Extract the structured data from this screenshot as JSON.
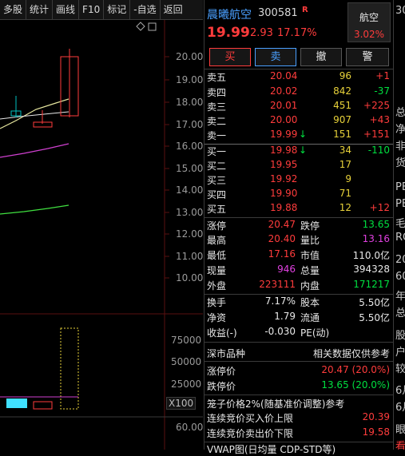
{
  "toolbar": {
    "buttons": [
      "多股",
      "统计",
      "画线",
      "F10",
      "标记",
      "-自选",
      "返回"
    ]
  },
  "chart": {
    "price_ticks": [
      "20.00",
      "19.00",
      "18.00",
      "17.00",
      "16.00",
      "15.00",
      "14.00",
      "13.00",
      "12.00",
      "11.00",
      "10.00"
    ],
    "volume_ticks": [
      "75000",
      "50000",
      "25000"
    ],
    "volume_unit": "X100",
    "bottom_tick": "60.00"
  },
  "stock": {
    "name": "晨曦航空",
    "code": "300581",
    "badge": "R",
    "price": "19.99",
    "change": "2.93",
    "change_pct": "17.17%",
    "sector": "航空",
    "sector_pct": "3.02%"
  },
  "actions": [
    "买",
    "卖",
    "撤",
    "警"
  ],
  "asks": [
    {
      "label": "卖五",
      "price": "20.04",
      "vol": "96",
      "delta": "+1"
    },
    {
      "label": "卖四",
      "price": "20.02",
      "vol": "842",
      "delta": "-37"
    },
    {
      "label": "卖三",
      "price": "20.01",
      "vol": "451",
      "delta": "+225"
    },
    {
      "label": "卖二",
      "price": "20.00",
      "vol": "907",
      "delta": "+43"
    },
    {
      "label": "卖一",
      "price": "19.99",
      "vol": "151",
      "delta": "+151"
    }
  ],
  "bids": [
    {
      "label": "买一",
      "price": "19.98",
      "vol": "34",
      "delta": "-110"
    },
    {
      "label": "买二",
      "price": "19.95",
      "vol": "17",
      "delta": ""
    },
    {
      "label": "买三",
      "price": "19.92",
      "vol": "9",
      "delta": ""
    },
    {
      "label": "买四",
      "price": "19.90",
      "vol": "71",
      "delta": ""
    },
    {
      "label": "买五",
      "price": "19.88",
      "vol": "12",
      "delta": "+12"
    }
  ],
  "stats": [
    {
      "l1": "涨停",
      "v1": "20.47",
      "l2": "跌停",
      "v2": "13.65"
    },
    {
      "l1": "最高",
      "v1": "20.40",
      "l2": "量比",
      "v2": "13.16"
    },
    {
      "l1": "最低",
      "v1": "17.16",
      "l2": "市值",
      "v2": "110.0亿"
    },
    {
      "l1": "现量",
      "v1": "946",
      "l2": "总量",
      "v2": "394328"
    },
    {
      "l1": "外盘",
      "v1": "223111",
      "l2": "内盘",
      "v2": "171217"
    }
  ],
  "fundamentals": [
    {
      "l1": "换手",
      "v1": "7.17%",
      "l2": "股本",
      "v2": "5.50亿"
    },
    {
      "l1": "净资",
      "v1": "1.79",
      "l2": "流通",
      "v2": "5.50亿"
    },
    {
      "l1": "收益(-)",
      "v1": "-0.030",
      "l2": "PE(动)",
      "v2": ""
    }
  ],
  "market": {
    "title": "深市品种",
    "note": "相关数据仅供参考",
    "limit_up_label": "涨停价",
    "limit_up_value": "20.47 (20.0%)",
    "limit_down_label": "跌停价",
    "limit_down_value": "13.65 (20.0%)",
    "cage_label": "笼子价格2%(随基准价调整)参考",
    "buy_cap_label": "连续竞价买入价上限",
    "buy_cap_value": "20.39",
    "sell_cap_label": "连续竞价卖出价下限",
    "sell_cap_value": "19.58",
    "vwap_label": "VWAP图(日均量 CDP-STD等)"
  },
  "edge_text": [
    "30",
    "总",
    "净",
    "非",
    "货",
    "PE",
    "PE",
    "毛",
    "RO",
    "20",
    "60",
    "年",
    "总",
    "股",
    "户",
    "较",
    "6月",
    "6月",
    "眼",
    "看"
  ],
  "colors": {
    "up": "#ff3c3c",
    "down": "#00e040",
    "volume": "#e8d23a"
  }
}
